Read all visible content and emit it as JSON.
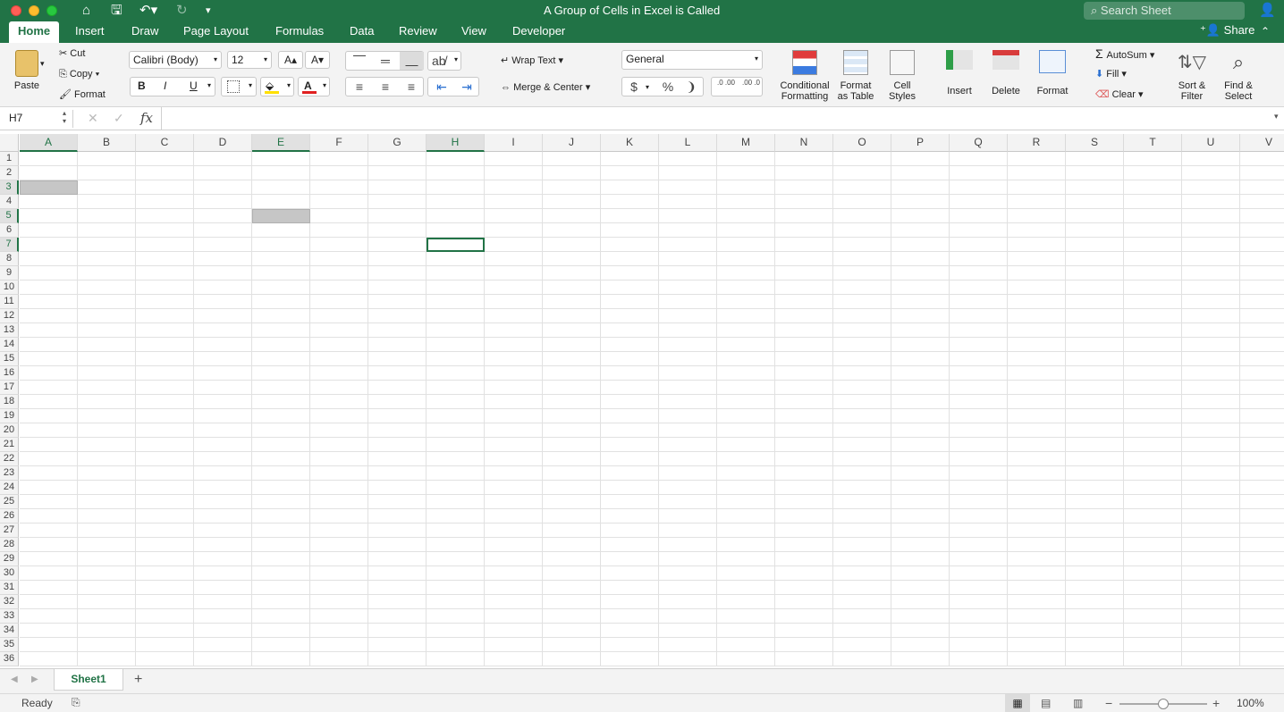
{
  "window": {
    "title": "A Group of Cells in Excel is Called"
  },
  "search": {
    "placeholder": "Search Sheet"
  },
  "tabs": [
    "Home",
    "Insert",
    "Draw",
    "Page Layout",
    "Formulas",
    "Data",
    "Review",
    "View",
    "Developer"
  ],
  "share_label": "Share",
  "clipboard": {
    "paste": "Paste",
    "cut": "Cut",
    "copy": "Copy",
    "format": "Format"
  },
  "font": {
    "name": "Calibri (Body)",
    "size": "12",
    "bold": "B",
    "italic": "I",
    "underline": "U"
  },
  "alignment": {
    "wrap_text": "Wrap Text",
    "merge_center": "Merge & Center"
  },
  "number": {
    "format": "General",
    "currency": "$",
    "percent": "%",
    "comma": "❩",
    "inc_decimal": ".0 .00",
    "dec_decimal": ".00 .0"
  },
  "styles": {
    "conditional": [
      "Conditional",
      "Formatting"
    ],
    "format_table": [
      "Format",
      "as Table"
    ],
    "cell_styles": [
      "Cell",
      "Styles"
    ]
  },
  "cells_group": {
    "insert": "Insert",
    "delete": "Delete",
    "format": "Format"
  },
  "editing": {
    "autosum": "AutoSum",
    "fill": "Fill",
    "clear": "Clear",
    "sort_filter": [
      "Sort &",
      "Filter"
    ],
    "find_select": [
      "Find &",
      "Select"
    ]
  },
  "formula_bar": {
    "name_box": "H7",
    "fx": "fx",
    "value": ""
  },
  "columns": [
    "A",
    "B",
    "C",
    "D",
    "E",
    "F",
    "G",
    "H",
    "I",
    "J",
    "K",
    "L",
    "M",
    "N",
    "O",
    "P",
    "Q",
    "R",
    "S",
    "T",
    "U",
    "V"
  ],
  "rows": [
    "1",
    "2",
    "3",
    "4",
    "5",
    "6",
    "7",
    "8",
    "9",
    "10",
    "11",
    "12",
    "13",
    "14",
    "15",
    "16",
    "17",
    "18",
    "19",
    "20",
    "21",
    "22",
    "23",
    "24",
    "25",
    "26",
    "27",
    "28",
    "29",
    "30",
    "31",
    "32",
    "33",
    "34",
    "35",
    "36"
  ],
  "selection": {
    "active_cell": "H7",
    "highlighted_cells": [
      "A3",
      "E5"
    ],
    "highlighted_columns": [
      "A",
      "E",
      "H"
    ],
    "highlighted_rows": [
      "3",
      "5",
      "7"
    ]
  },
  "sheets": [
    "Sheet1"
  ],
  "status": {
    "ready": "Ready",
    "zoom": "100%"
  },
  "colors": {
    "brand": "#217346",
    "highlight": "#c6c6c6",
    "selection_border": "#217346"
  }
}
